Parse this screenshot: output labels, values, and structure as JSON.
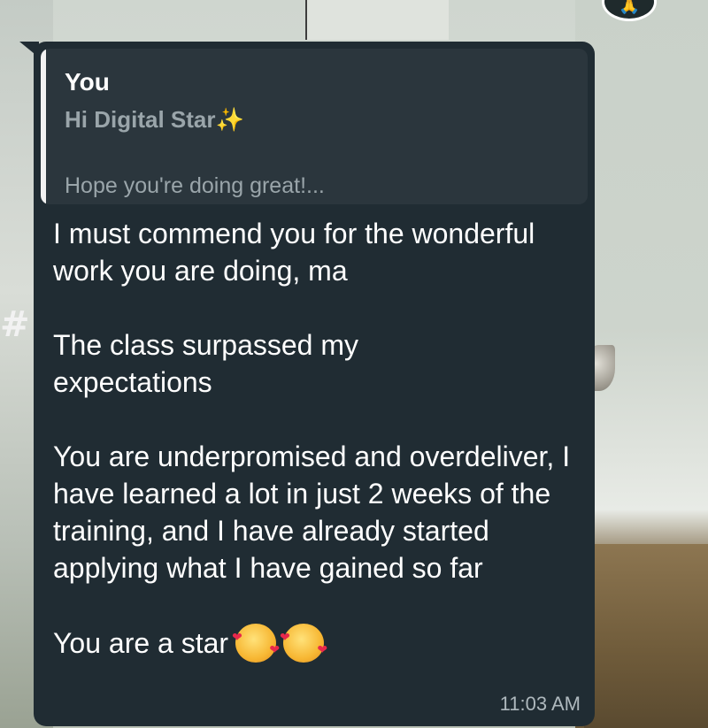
{
  "message": {
    "quote": {
      "author": "You",
      "line1": "Hi Digital Star",
      "line1_emoji": "✨",
      "line2": "Hope you're doing great!..."
    },
    "paragraphs": [
      "I must commend you for the wonderful work you are doing, ma",
      "The class surpassed my expectations",
      "You are underpromised and overdeliver, I have learned a lot in just 2 weeks of the training, and I have already started applying what I have gained so far"
    ],
    "last_line": "You are a star",
    "last_line_emojis": [
      "smiling-face-with-hearts-icon",
      "smiling-face-with-hearts-icon"
    ],
    "timestamp": "11:03 AM"
  },
  "header": {
    "avatar_emoji": "🙏"
  },
  "colors": {
    "bubble": "#202c33",
    "quote_bg": "#2b363d",
    "quote_bar": "#f2f2f2",
    "text": "#ffffff",
    "muted": "#9aa5aa"
  }
}
